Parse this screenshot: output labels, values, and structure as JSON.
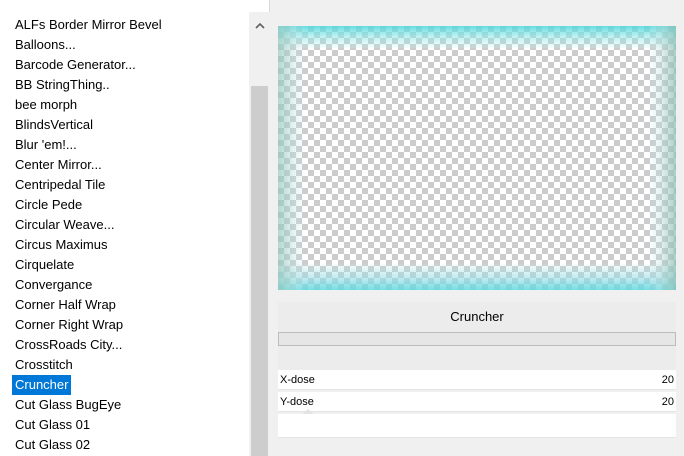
{
  "filter_list": {
    "items": [
      "ALFs Border Mirror Bevel",
      "Balloons...",
      "Barcode Generator...",
      "BB StringThing..",
      "bee morph",
      "BlindsVertical",
      "Blur 'em!...",
      "Center Mirror...",
      "Centripedal Tile",
      "Circle Pede",
      "Circular Weave...",
      "Circus Maximus",
      "Cirquelate",
      "Convergance",
      "Corner Half Wrap",
      "Corner Right Wrap",
      "CrossRoads City...",
      "Crosstitch",
      "Cruncher",
      "Cut Glass  BugEye",
      "Cut Glass 01",
      "Cut Glass 02"
    ],
    "selected": "Cruncher"
  },
  "scrollbar": {
    "up_icon": "chevron-up-icon"
  },
  "preview": {
    "colors": {
      "border_cyan": "#4fd7dc",
      "checker": "#cccccc"
    }
  },
  "filter_panel": {
    "title": "Cruncher",
    "params": [
      {
        "name": "X-dose",
        "value": "20"
      },
      {
        "name": "Y-dose",
        "value": "20"
      }
    ]
  },
  "colors": {
    "selection": "#0078d7",
    "panel_bg": "#f0f0f0"
  }
}
